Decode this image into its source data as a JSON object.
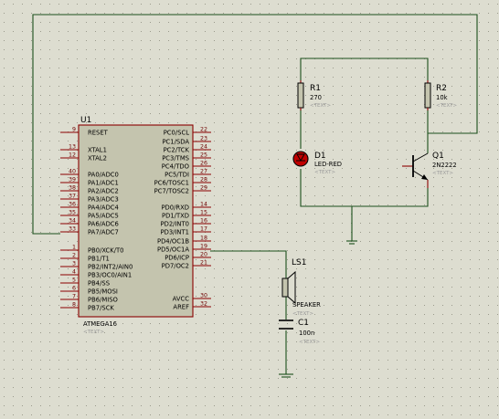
{
  "u1": {
    "ref": "U1",
    "part": "ATMEGA16",
    "text": "<TEXT>",
    "left_pins": [
      {
        "num": "9",
        "name": "RESET"
      },
      {
        "num": "13",
        "name": "XTAL1"
      },
      {
        "num": "12",
        "name": "XTAL2"
      },
      {
        "num": "40",
        "name": "PA0/ADC0"
      },
      {
        "num": "39",
        "name": "PA1/ADC1"
      },
      {
        "num": "38",
        "name": "PA2/ADC2"
      },
      {
        "num": "37",
        "name": "PA3/ADC3"
      },
      {
        "num": "36",
        "name": "PA4/ADC4"
      },
      {
        "num": "35",
        "name": "PA5/ADC5"
      },
      {
        "num": "34",
        "name": "PA6/ADC6"
      },
      {
        "num": "33",
        "name": "PA7/ADC7"
      },
      {
        "num": "1",
        "name": "PB0/XCK/T0"
      },
      {
        "num": "2",
        "name": "PB1/T1"
      },
      {
        "num": "3",
        "name": "PB2/INT2/AIN0"
      },
      {
        "num": "4",
        "name": "PB3/OC0/AIN1"
      },
      {
        "num": "5",
        "name": "PB4/SS"
      },
      {
        "num": "6",
        "name": "PB5/MOSI"
      },
      {
        "num": "7",
        "name": "PB6/MISO"
      },
      {
        "num": "8",
        "name": "PB7/SCK"
      }
    ],
    "right_pins": [
      {
        "num": "22",
        "name": "PC0/SCL"
      },
      {
        "num": "23",
        "name": "PC1/SDA"
      },
      {
        "num": "24",
        "name": "PC2/TCK"
      },
      {
        "num": "25",
        "name": "PC3/TMS"
      },
      {
        "num": "26",
        "name": "PC4/TDO"
      },
      {
        "num": "27",
        "name": "PC5/TDI"
      },
      {
        "num": "28",
        "name": "PC6/TOSC1"
      },
      {
        "num": "29",
        "name": "PC7/TOSC2"
      },
      {
        "num": "14",
        "name": "PD0/RXD"
      },
      {
        "num": "15",
        "name": "PD1/TXD"
      },
      {
        "num": "16",
        "name": "PD2/INT0"
      },
      {
        "num": "17",
        "name": "PD3/INT1"
      },
      {
        "num": "18",
        "name": "PD4/OC1B"
      },
      {
        "num": "19",
        "name": "PD5/OC1A"
      },
      {
        "num": "20",
        "name": "PD6/ICP"
      },
      {
        "num": "21",
        "name": "PD7/OC2"
      },
      {
        "num": "30",
        "name": "AVCC"
      },
      {
        "num": "32",
        "name": "AREF"
      }
    ]
  },
  "r1": {
    "ref": "R1",
    "value": "270",
    "text": "<TEXT>"
  },
  "r2": {
    "ref": "R2",
    "value": "10k",
    "text": "<TEXT>"
  },
  "d1": {
    "ref": "D1",
    "value": "LED-RED",
    "text": "<TEXT>"
  },
  "q1": {
    "ref": "Q1",
    "value": "2N2222",
    "text": "<TEXT>"
  },
  "ls1": {
    "ref": "LS1",
    "value": "SPEAKER",
    "text": "<TEXT>"
  },
  "c1": {
    "ref": "C1",
    "value": "100n",
    "text": "<TEXT>"
  },
  "colors": {
    "background": "#ddddd0",
    "wire": "#1c4f1c",
    "component": "#8b0000",
    "chip_fill": "#c4c4ae",
    "led_fill": "#c00000",
    "placeholder": "#9a9a9a"
  }
}
